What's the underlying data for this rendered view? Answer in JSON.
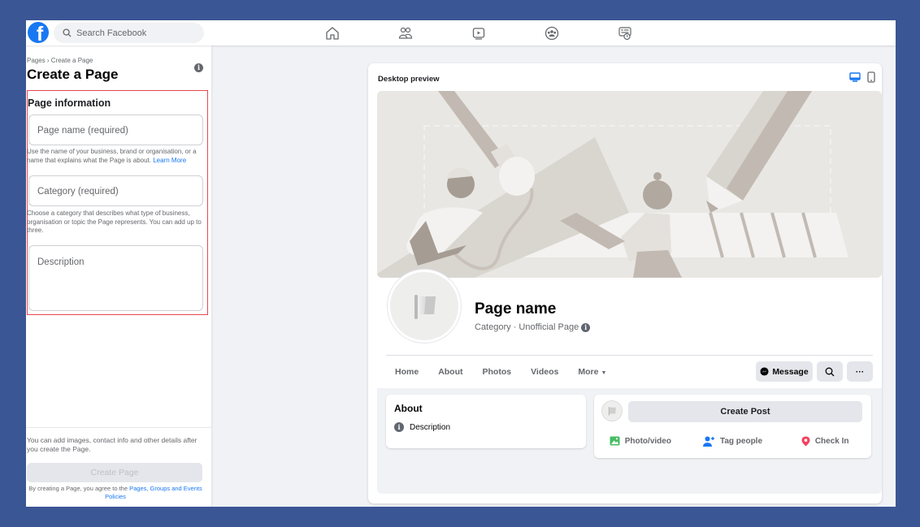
{
  "topbar": {
    "logo": "facebook-logo",
    "logo_glyph": "f",
    "search_placeholder": "Search Facebook",
    "nav": [
      {
        "icon": "home-icon",
        "label": "Home"
      },
      {
        "icon": "friends-icon",
        "label": "Friends"
      },
      {
        "icon": "watch-icon",
        "label": "Watch"
      },
      {
        "icon": "groups-icon",
        "label": "Groups"
      },
      {
        "icon": "memories-icon",
        "label": "Memories"
      }
    ]
  },
  "sidebar": {
    "breadcrumb": "Pages › Create a Page",
    "title": "Create a Page",
    "info_glyph": "i",
    "form": {
      "heading": "Page information",
      "page_name_placeholder": "Page name (required)",
      "page_name_hint": "Use the name of your business, brand or organisation, or a name that explains what the Page is about.",
      "learn_more": "Learn More",
      "category_placeholder": "Category (required)",
      "category_hint": "Choose a category that describes what type of business, organisation or topic the Page represents. You can add up to three.",
      "description_placeholder": "Description"
    },
    "footer": {
      "note": "You can add images, contact info and other details after you create the Page.",
      "create_button": "Create Page",
      "terms_prefix": "By creating a Page, you agree to the",
      "terms_link": "Pages, Groups and Events Policies"
    }
  },
  "preview": {
    "label": "Desktop preview",
    "modes": [
      {
        "icon": "desktop-icon",
        "active": true,
        "color": "#1877f2"
      },
      {
        "icon": "mobile-icon",
        "active": false,
        "color": "#65676b"
      }
    ],
    "page_name": "Page name",
    "page_sub": "Category · Unofficial Page",
    "info_glyph": "i",
    "tabs": [
      "Home",
      "About",
      "Photos",
      "Videos",
      "More"
    ],
    "more_caret": "▼",
    "message_button": "Message",
    "more_button_glyph": "···",
    "about": {
      "title": "About",
      "description": "Description",
      "info_glyph": "i"
    },
    "composer": {
      "create_post": "Create Post",
      "actions": [
        {
          "icon": "photo-video-icon",
          "label": "Photo/video",
          "color": "#45bd62"
        },
        {
          "icon": "tag-people-icon",
          "label": "Tag people",
          "color": "#1877f2"
        },
        {
          "icon": "check-in-icon",
          "label": "Check In",
          "color": "#f3425f"
        }
      ]
    }
  },
  "colors": {
    "background": "#3b5694",
    "brand": "#1877f2",
    "highlight_border": "#e4474f"
  }
}
